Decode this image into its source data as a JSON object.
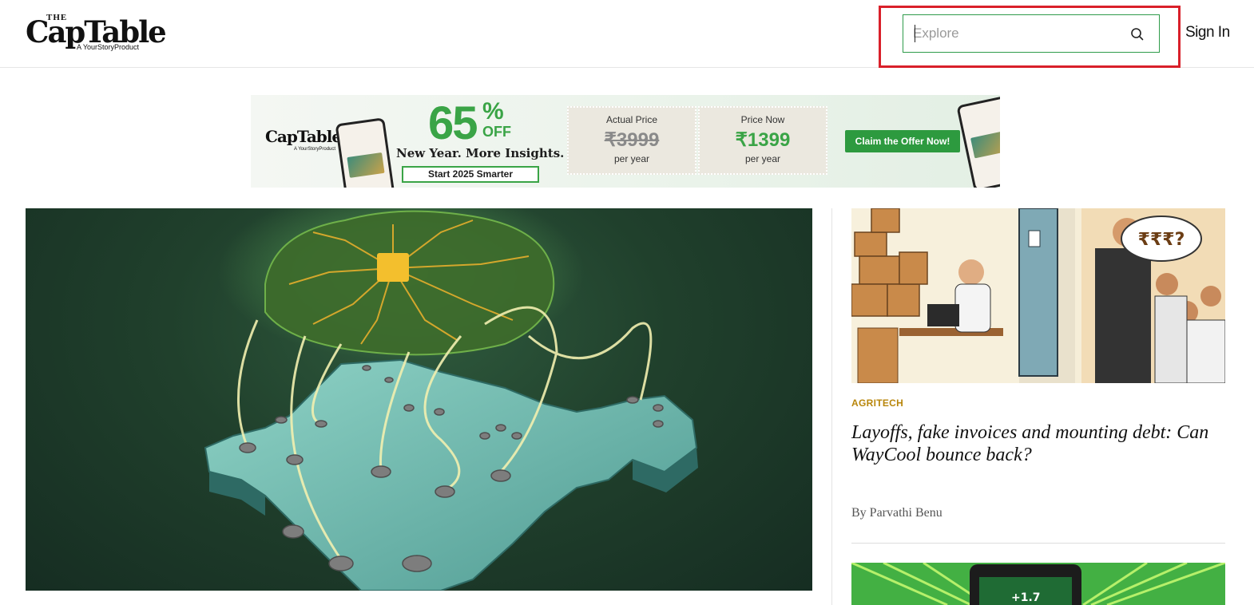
{
  "header": {
    "logo_the": "THE",
    "logo_word": "CapTable",
    "logo_sub": "A YourStoryProduct",
    "search_placeholder": "Explore",
    "signin_label": "Sign In"
  },
  "banner": {
    "logo_word": "CapTable",
    "logo_sub": "A YourStoryProduct",
    "percent": "65",
    "percent_sign": "%",
    "off": "OFF",
    "tagline": "New Year. More Insights.",
    "button_small": "Start 2025 Smarter",
    "actual_label": "Actual Price",
    "actual_price": "₹3999",
    "now_label": "Price Now",
    "now_price": "₹1399",
    "per_year": "per year",
    "cta": "Claim the Offer Now!"
  },
  "sidebar": {
    "article1": {
      "category": "AGRITECH",
      "headline": "Layoffs, fake invoices and mounting debt: Can WayCool bounce back?",
      "byline": "By Parvathi Benu",
      "image_text": "₹₹₹?"
    },
    "article2": {
      "image_text": "+1.7"
    }
  },
  "colors": {
    "brand_green": "#3aa446",
    "highlight_red": "#d9202a",
    "category_gold": "#b8860b"
  }
}
